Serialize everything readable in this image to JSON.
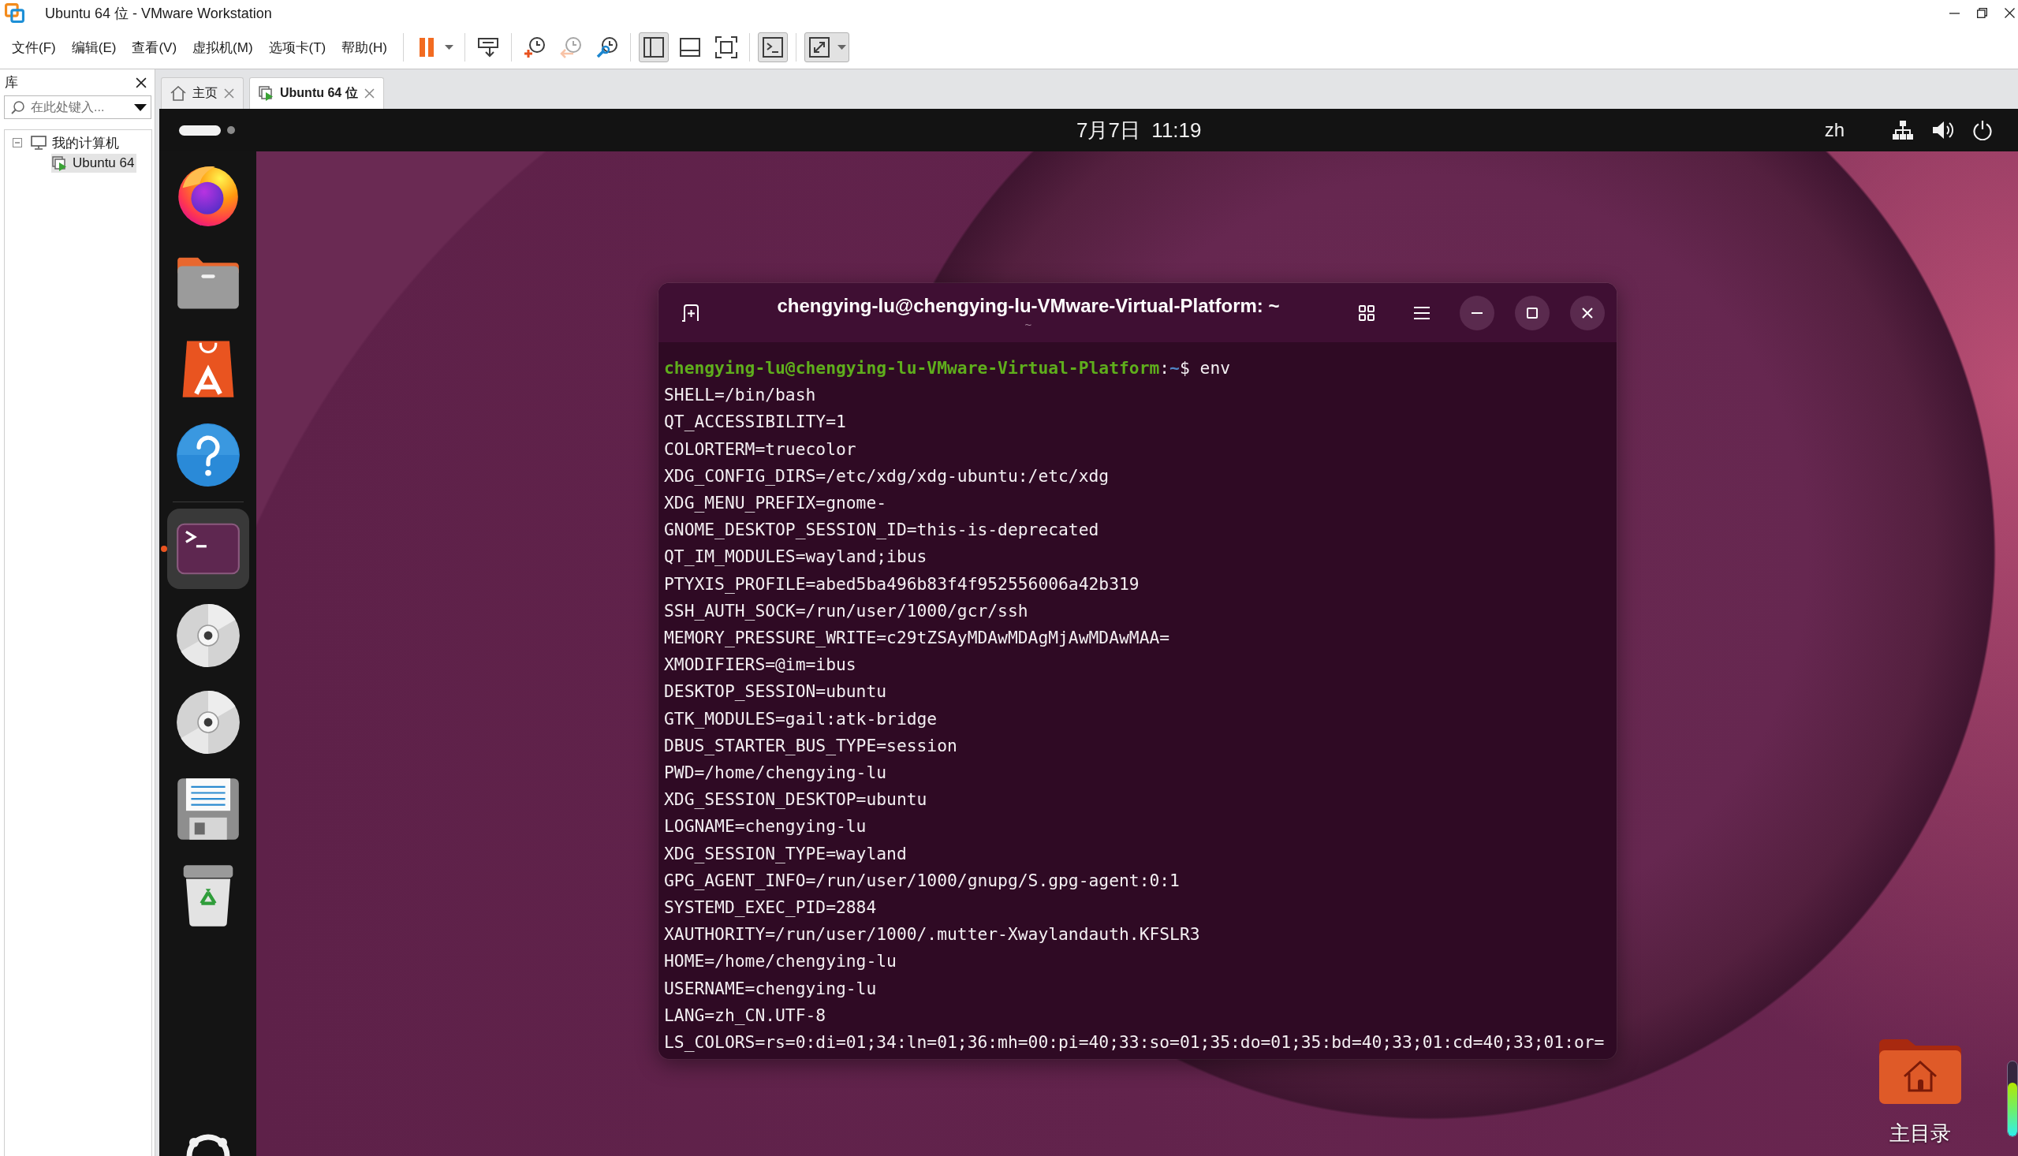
{
  "window": {
    "title": "Ubuntu 64 位 - VMware Workstation"
  },
  "menu": [
    "文件(F)",
    "编辑(E)",
    "查看(V)",
    "虚拟机(M)",
    "选项卡(T)",
    "帮助(H)"
  ],
  "toolbar": [
    [
      {
        "kind": "pause",
        "pressed": false,
        "disabled": false,
        "dropdown": true
      }
    ],
    [
      {
        "kind": "send-keys",
        "pressed": false,
        "disabled": false,
        "dropdown": false
      }
    ],
    [
      {
        "kind": "snapshot-take",
        "pressed": false,
        "disabled": false,
        "dropdown": false
      },
      {
        "kind": "snapshot-revert",
        "pressed": false,
        "disabled": true,
        "dropdown": false
      },
      {
        "kind": "snapshot-manage",
        "pressed": false,
        "disabled": false,
        "dropdown": false
      }
    ],
    [
      {
        "kind": "library",
        "pressed": true,
        "disabled": false,
        "dropdown": false
      },
      {
        "kind": "thumbnails",
        "pressed": false,
        "disabled": false,
        "dropdown": false
      },
      {
        "kind": "fullscreen",
        "pressed": false,
        "disabled": false,
        "dropdown": false
      }
    ],
    [
      {
        "kind": "console",
        "pressed": true,
        "disabled": false,
        "dropdown": false
      }
    ],
    [
      {
        "kind": "stretch",
        "pressed": true,
        "disabled": false,
        "dropdown": true
      }
    ]
  ],
  "library": {
    "title": "库",
    "search": {
      "placeholder": "在此处键入..."
    },
    "tree": [
      {
        "kind": "computer",
        "label": "我的计算机",
        "expanded": true,
        "selected": false,
        "children": [
          {
            "kind": "vm",
            "label": "Ubuntu 64",
            "selected": true
          }
        ]
      }
    ]
  },
  "tabs": [
    {
      "kind": "home",
      "label": "主页",
      "selected": false
    },
    {
      "kind": "vm",
      "label": "Ubuntu 64 位",
      "selected": true
    }
  ],
  "top_bar": {
    "workspaces": [
      {
        "selected": true
      },
      {
        "selected": false
      }
    ],
    "clock": "7月7日  11:19",
    "input_source": "zh"
  },
  "dock": {
    "pinned": [
      {
        "kind": "browser",
        "running": false,
        "focused": false
      },
      {
        "kind": "files",
        "running": false,
        "focused": false
      },
      {
        "kind": "app-store",
        "running": false,
        "focused": false
      },
      {
        "kind": "help",
        "running": false,
        "focused": false
      }
    ],
    "others": [
      {
        "kind": "terminal",
        "running": true,
        "focused": true
      },
      {
        "kind": "disc",
        "running": false,
        "focused": false
      },
      {
        "kind": "disc",
        "running": false,
        "focused": false
      },
      {
        "kind": "floppy",
        "running": false,
        "focused": false
      },
      {
        "kind": "trash",
        "running": false,
        "focused": false
      }
    ]
  },
  "terminal": {
    "title": "chengying-lu@chengying-lu-VMware-Virtual-Platform: ~",
    "subtitle": "~",
    "prompt": {
      "user_host": "chengying-lu@chengying-lu-VMware-Virtual-Platform",
      "separator": ":",
      "path": "~",
      "symbol": "$",
      "command": "env"
    },
    "output": [
      "SHELL=/bin/bash",
      "QT_ACCESSIBILITY=1",
      "COLORTERM=truecolor",
      "XDG_CONFIG_DIRS=/etc/xdg/xdg-ubuntu:/etc/xdg",
      "XDG_MENU_PREFIX=gnome-",
      "GNOME_DESKTOP_SESSION_ID=this-is-deprecated",
      "QT_IM_MODULES=wayland;ibus",
      "PTYXIS_PROFILE=abed5ba496b83f4f952556006a42b319",
      "SSH_AUTH_SOCK=/run/user/1000/gcr/ssh",
      "MEMORY_PRESSURE_WRITE=c29tZSAyMDAwMDAgMjAwMDAwMAA=",
      "XMODIFIERS=@im=ibus",
      "DESKTOP_SESSION=ubuntu",
      "GTK_MODULES=gail:atk-bridge",
      "DBUS_STARTER_BUS_TYPE=session",
      "PWD=/home/chengying-lu",
      "XDG_SESSION_DESKTOP=ubuntu",
      "LOGNAME=chengying-lu",
      "XDG_SESSION_TYPE=wayland",
      "GPG_AGENT_INFO=/run/user/1000/gnupg/S.gpg-agent:0:1",
      "SYSTEMD_EXEC_PID=2884",
      "XAUTHORITY=/run/user/1000/.mutter-Xwaylandauth.KFSLR3",
      "HOME=/home/chengying-lu",
      "USERNAME=chengying-lu",
      "LANG=zh_CN.UTF-8",
      "LS_COLORS=rs=0:di=01;34:ln=01;36:mh=00:pi=40;33:so=01;35:do=01;35:bd=40;33;01:cd=40;33;01:or="
    ]
  },
  "desktop_icons": [
    {
      "kind": "home-folder",
      "label": "主目录"
    }
  ],
  "meter": {
    "level": 0.72
  }
}
